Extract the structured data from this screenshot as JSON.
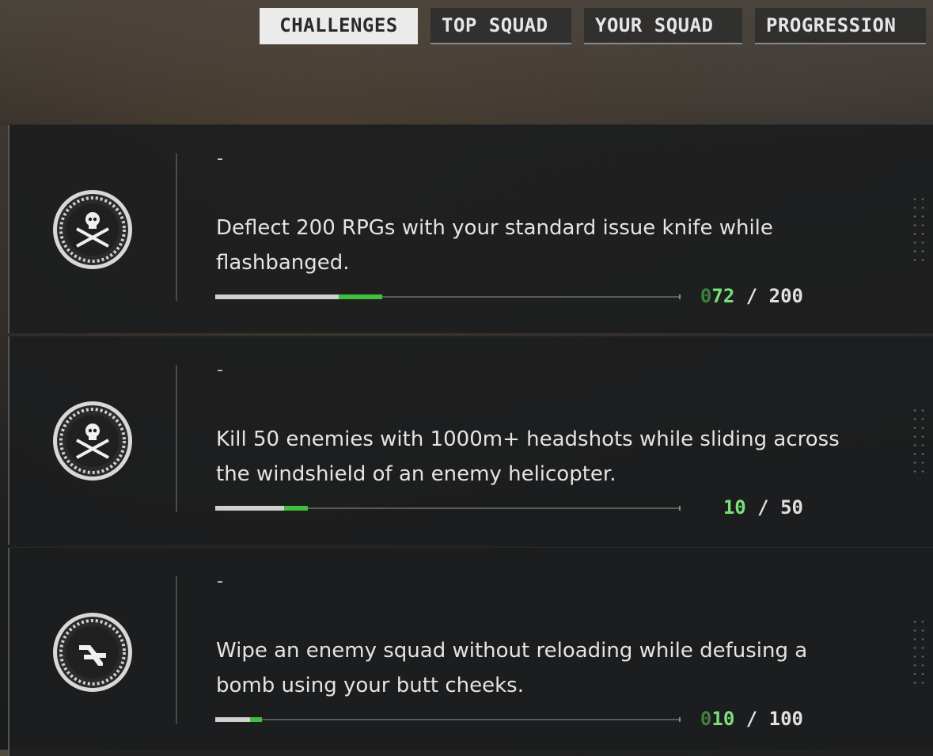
{
  "tabs": [
    {
      "label": "CHALLENGES",
      "active": true
    },
    {
      "label": "TOP SQUAD",
      "active": false
    },
    {
      "label": "YOUR SQUAD",
      "active": false
    },
    {
      "label": "PROGRESSION",
      "active": false
    }
  ],
  "challenges": [
    {
      "icon": "skull-crossed-knives-icon",
      "dash": "-",
      "description": "Deflect 200 RPGs with your standard issue knife while flashbanged.",
      "progress_pad": "0",
      "progress_current": "72",
      "progress_separator": " / ",
      "progress_total": "200",
      "progress_fraction": 0.36
    },
    {
      "icon": "skull-crossed-knives-icon",
      "dash": "-",
      "description": "Kill 50 enemies with 1000m+ headshots while sliding across the windshield of an enemy helicopter.",
      "progress_pad": "",
      "progress_current": "10",
      "progress_separator": " / ",
      "progress_total": "50",
      "progress_fraction": 0.2
    },
    {
      "icon": "squad-wipe-icon",
      "dash": "-",
      "description": "Wipe an enemy squad without reloading while defusing a bomb using your butt cheeks.",
      "progress_pad": "0",
      "progress_current": "10",
      "progress_separator": " / ",
      "progress_total": "100",
      "progress_fraction": 0.1
    }
  ],
  "colors": {
    "accent_green": "#3fc03f",
    "progress_text_green": "#7be07b"
  }
}
